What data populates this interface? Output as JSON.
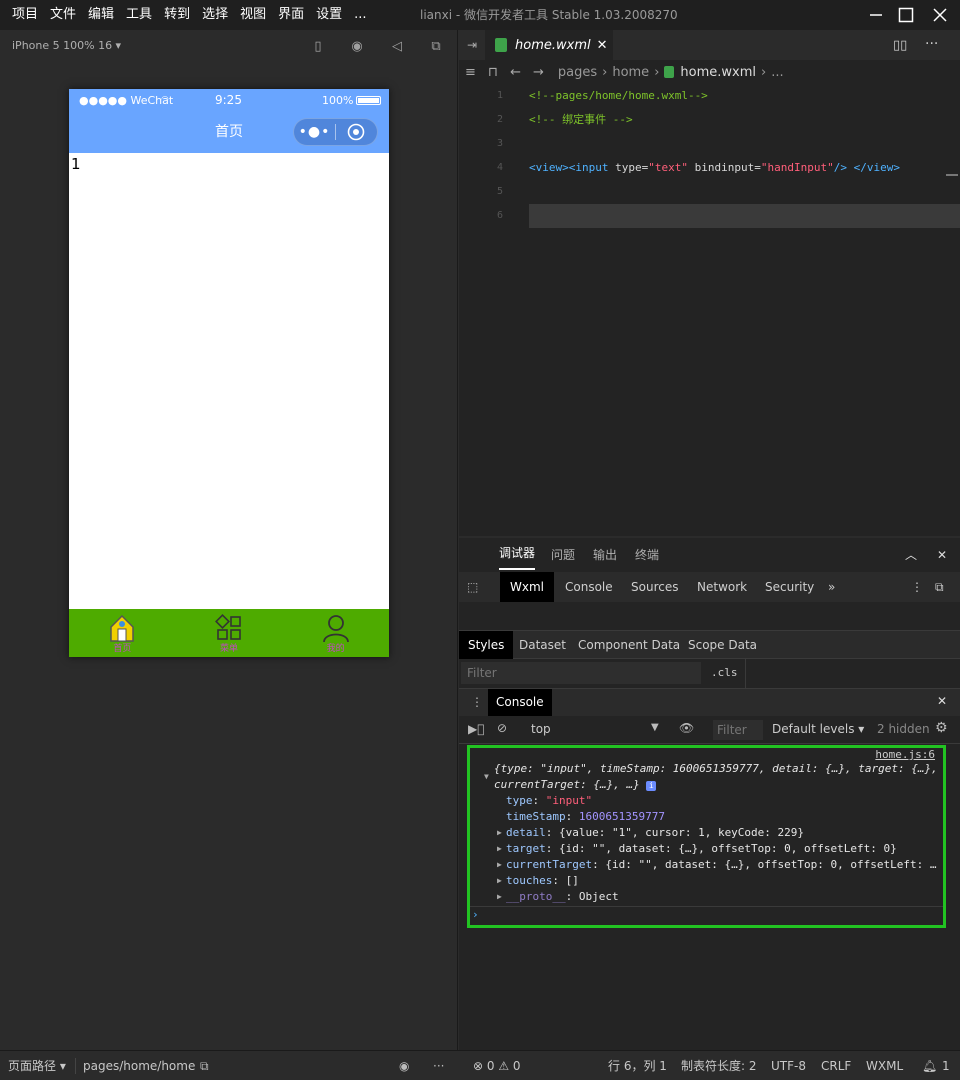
{
  "menu": [
    "项目",
    "文件",
    "编辑",
    "工具",
    "转到",
    "选择",
    "视图",
    "界面",
    "设置",
    "..."
  ],
  "window_title": "lianxi - 微信开发者工具 Stable 1.03.2008270",
  "simulator": {
    "device": "iPhone 5 100% 16 ▾",
    "status_left": "●●●●● WeChat",
    "status_time": "9:25",
    "status_battery": "100%",
    "nav_title": "首页",
    "body_text": "1",
    "tabs": [
      {
        "label": "首页",
        "icon": "home-icon"
      },
      {
        "label": "菜单",
        "icon": "grid-icon"
      },
      {
        "label": "我的",
        "icon": "user-icon"
      }
    ]
  },
  "editor": {
    "file_tab": "home.wxml",
    "breadcrumb": [
      "pages",
      "home",
      "home.wxml",
      "..."
    ],
    "line_numbers": [
      "1",
      "2",
      "3",
      "4",
      "5",
      "6"
    ],
    "line1": "<!--pages/home/home.wxml-->",
    "line2": "<!-- 绑定事件 -->",
    "line4": {
      "open_view": "<view>",
      "open_input": "<input",
      "attr_type": " type=",
      "val_type": "\"text\"",
      "attr_bind": " bindinput=",
      "val_bind": "\"handInput\"",
      "close_input": "/>",
      "close_view": " </view>"
    }
  },
  "devtools": {
    "top_tabs": [
      "调试器",
      "问题",
      "输出",
      "终端"
    ],
    "tabs": [
      "Wxml",
      "Console",
      "Sources",
      "Network",
      "Security",
      "»"
    ],
    "style_tabs": [
      "Styles",
      "Dataset",
      "Component Data",
      "Scope Data"
    ],
    "filter_placeholder": "Filter",
    "cls_label": ".cls",
    "console_title": "Console",
    "context": "top",
    "console_filter": "Filter",
    "levels": "Default levels ▾",
    "hidden": "2 hidden",
    "log": {
      "source": "home.js:6",
      "summary1": "{type: \"input\", timeStamp: 1600651359777, detail: {…}, target: {…},",
      "summary2": "currentTarget: {…}, …}",
      "type_key": "type",
      "type_val": "\"input\"",
      "ts_key": "timeStamp",
      "ts_val": "1600651359777",
      "detail_key": "detail",
      "detail_val": "{value: \"1\", cursor: 1, keyCode: 229}",
      "target_key": "target",
      "target_val": "{id: \"\", dataset: {…}, offsetTop: 0, offsetLeft: 0}",
      "ct_key": "currentTarget",
      "ct_val": "{id: \"\", dataset: {…}, offsetTop: 0, offsetLeft: …",
      "touches_key": "touches",
      "touches_val": "[]",
      "proto_key": "__proto__",
      "proto_val": "Object"
    }
  },
  "statusbar": {
    "path_label": "页面路径 ▾",
    "path": "pages/home/home",
    "errors": "⊗ 0 ⚠ 0",
    "position": "行 6，列 1",
    "tab_size": "制表符长度: 2",
    "encoding": "UTF-8",
    "eol": "CRLF",
    "lang": "WXML",
    "notifications": "1"
  },
  "colors": {
    "phone_header": "#69a5ff",
    "tabbar": "#4eab00",
    "highlight_box": "#22c322"
  }
}
